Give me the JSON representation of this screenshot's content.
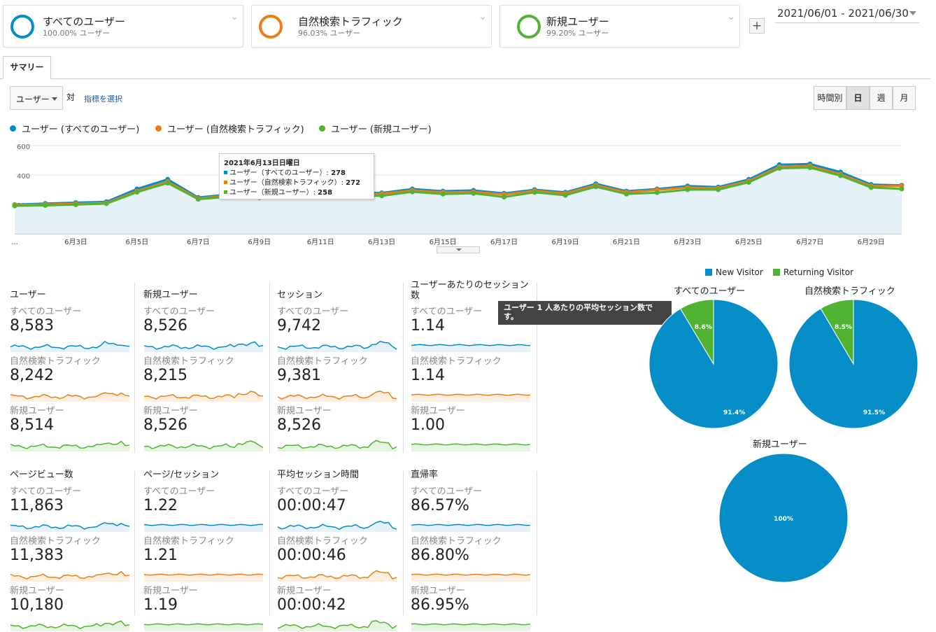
{
  "segments": [
    {
      "name": "すべてのユーザー",
      "percent": "100.00% ユーザー",
      "color": "#058dc7"
    },
    {
      "name": "自然検索トラフィック",
      "percent": "96.03% ユーザー",
      "color": "#ed7e17"
    },
    {
      "name": "新規ユーザー",
      "percent": "99.20% ユーザー",
      "color": "#50b432"
    }
  ],
  "add_segment": "+",
  "date_range": "2021/06/01 - 2021/06/30",
  "tab": "サマリー",
  "controls": {
    "metric": "ユーザー",
    "vs": "対",
    "pick_metric": "指標を選択",
    "gran_hour": "時間別",
    "gran_day": "日",
    "gran_week": "週",
    "gran_month": "月"
  },
  "legend": [
    "ユーザー (すべてのユーザー)",
    "ユーザー (自然検索トラフィック)",
    "ユーザー (新規ユーザー)"
  ],
  "chart_data": {
    "type": "line",
    "y_ticks": [
      "600",
      "400",
      "200"
    ],
    "ylim": [
      0,
      600
    ],
    "x_tick_labels": [
      "...",
      "6月3日",
      "6月5日",
      "6月7日",
      "6月9日",
      "6月11日",
      "6月13日",
      "6月15日",
      "6月17日",
      "6月19日",
      "6月21日",
      "6月23日",
      "6月25日",
      "6月27日",
      "6月29日"
    ],
    "x": [
      "6/1",
      "6/2",
      "6/3",
      "6/4",
      "6/5",
      "6/6",
      "6/7",
      "6/8",
      "6/9",
      "6/10",
      "6/11",
      "6/12",
      "6/13",
      "6/14",
      "6/15",
      "6/16",
      "6/17",
      "6/18",
      "6/19",
      "6/20",
      "6/21",
      "6/22",
      "6/23",
      "6/24",
      "6/25",
      "6/26",
      "6/27",
      "6/28",
      "6/29",
      "6/30"
    ],
    "series": [
      {
        "name": "ユーザー (すべてのユーザー)",
        "color": "#058dc7",
        "values": [
          198,
          206,
          212,
          218,
          305,
          370,
          247,
          268,
          255,
          272,
          285,
          282,
          278,
          305,
          290,
          295,
          275,
          300,
          282,
          340,
          290,
          305,
          325,
          318,
          370,
          470,
          475,
          420,
          335,
          330
        ]
      },
      {
        "name": "ユーザー (自然検索トラフィック)",
        "color": "#ed7e17",
        "values": [
          195,
          200,
          205,
          210,
          290,
          355,
          240,
          260,
          248,
          265,
          278,
          276,
          272,
          295,
          282,
          285,
          268,
          292,
          275,
          330,
          282,
          298,
          315,
          310,
          360,
          455,
          462,
          405,
          325,
          325
        ]
      },
      {
        "name": "ユーザー (新規ユーザー)",
        "color": "#50b432",
        "values": [
          190,
          193,
          198,
          205,
          283,
          345,
          235,
          252,
          245,
          258,
          270,
          262,
          258,
          285,
          270,
          275,
          250,
          282,
          262,
          320,
          270,
          280,
          300,
          300,
          350,
          445,
          450,
          395,
          315,
          305
        ]
      }
    ]
  },
  "tooltip": {
    "title": "2021年6月13日日曜日",
    "rows": [
      {
        "label": "ユーザー（すべてのユーザー）: ",
        "value": "278",
        "color": "#058dc7"
      },
      {
        "label": "ユーザー（自然検索トラフィック）: ",
        "value": "272",
        "color": "#ed7e17"
      },
      {
        "label": "ユーザー（新規ユーザー）: ",
        "value": "258",
        "color": "#50b432"
      }
    ]
  },
  "tiles": [
    {
      "title": "ユーザー",
      "rows": [
        {
          "seg": "すべてのユーザー",
          "value": "8,583"
        },
        {
          "seg": "自然検索トラフィック",
          "value": "8,242"
        },
        {
          "seg": "新規ユーザー",
          "value": "8,514"
        }
      ]
    },
    {
      "title": "新規ユーザー",
      "rows": [
        {
          "seg": "すべてのユーザー",
          "value": "8,526"
        },
        {
          "seg": "自然検索トラフィック",
          "value": "8,215"
        },
        {
          "seg": "新規ユーザー",
          "value": "8,526"
        }
      ]
    },
    {
      "title": "セッション",
      "rows": [
        {
          "seg": "すべてのユーザー",
          "value": "9,742"
        },
        {
          "seg": "自然検索トラフィック",
          "value": "9,381"
        },
        {
          "seg": "新規ユーザー",
          "value": "8,526"
        }
      ]
    },
    {
      "title": "ユーザーあたりのセッション数",
      "rows": [
        {
          "seg": "すべてのユーザー",
          "value": "1.14"
        },
        {
          "seg": "自然検索トラフィック",
          "value": "1.14"
        },
        {
          "seg": "新規ユーザー",
          "value": "1.00"
        }
      ]
    },
    {
      "title": "ページビュー数",
      "rows": [
        {
          "seg": "すべてのユーザー",
          "value": "11,863"
        },
        {
          "seg": "自然検索トラフィック",
          "value": "11,383"
        },
        {
          "seg": "新規ユーザー",
          "value": "10,180"
        }
      ]
    },
    {
      "title": "ページ/セッション",
      "rows": [
        {
          "seg": "すべてのユーザー",
          "value": "1.22"
        },
        {
          "seg": "自然検索トラフィック",
          "value": "1.21"
        },
        {
          "seg": "新規ユーザー",
          "value": "1.19"
        }
      ]
    },
    {
      "title": "平均セッション時間",
      "rows": [
        {
          "seg": "すべてのユーザー",
          "value": "00:00:47"
        },
        {
          "seg": "自然検索トラフィック",
          "value": "00:00:46"
        },
        {
          "seg": "新規ユーザー",
          "value": "00:00:42"
        }
      ]
    },
    {
      "title": "直帰率",
      "rows": [
        {
          "seg": "すべてのユーザー",
          "value": "86.57%"
        },
        {
          "seg": "自然検索トラフィック",
          "value": "86.80%"
        },
        {
          "seg": "新規ユーザー",
          "value": "86.95%"
        }
      ]
    }
  ],
  "hover_tip": "ユーザー 1 人あたりの平均セッション数です。",
  "pie_legend": [
    {
      "label": "New Visitor",
      "color": "#058dc7"
    },
    {
      "label": "Returning Visitor",
      "color": "#50b432"
    }
  ],
  "pies": [
    {
      "title": "すべてのユーザー",
      "new": 91.4,
      "returning": 8.6,
      "new_label": "91.4%",
      "ret_label": "8.6%"
    },
    {
      "title": "自然検索トラフィック",
      "new": 91.5,
      "returning": 8.5,
      "new_label": "91.5%",
      "ret_label": "8.5%"
    },
    {
      "title": "新規ユーザー",
      "new": 100,
      "returning": 0,
      "new_label": "100%",
      "ret_label": ""
    }
  ]
}
